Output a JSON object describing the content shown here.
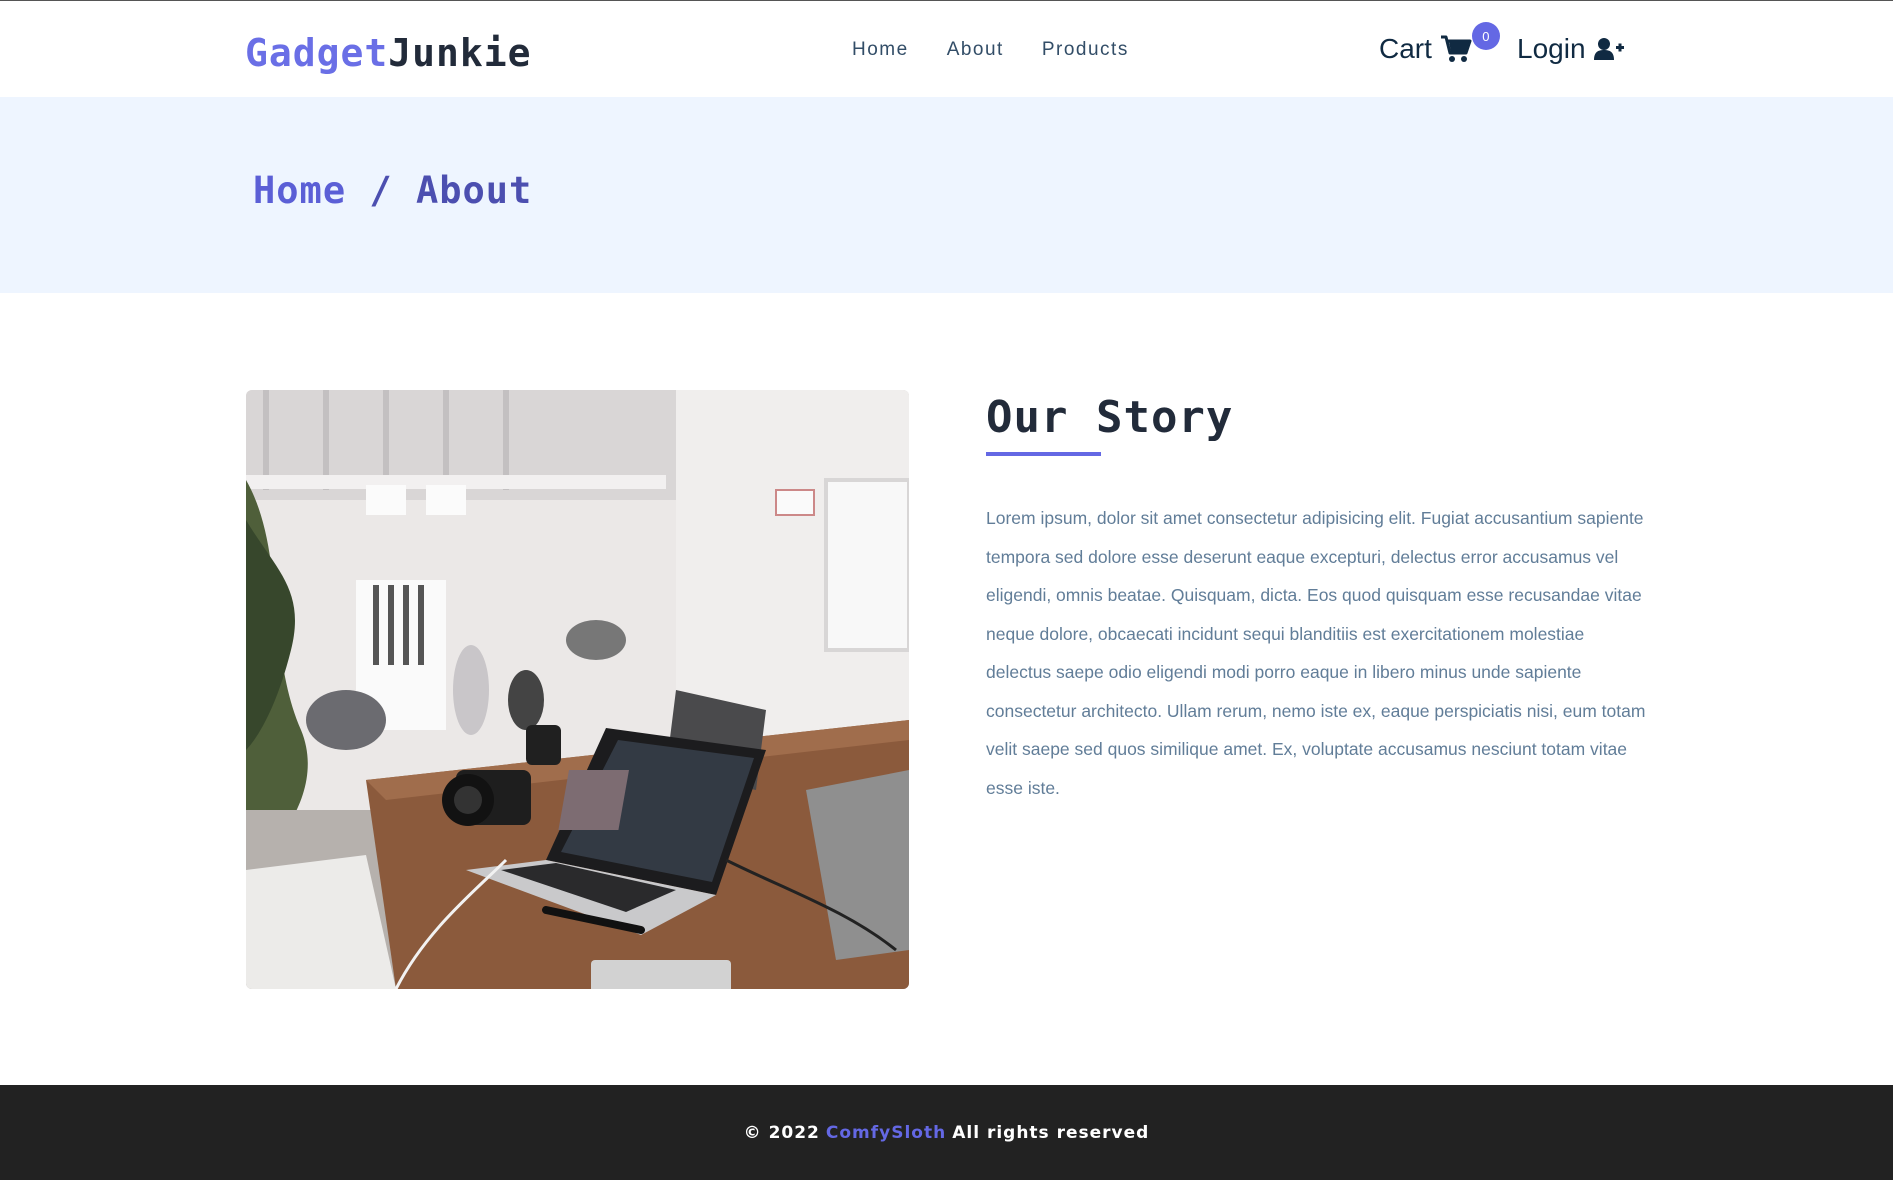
{
  "brand": {
    "part1": "Gadget",
    "part2": "Junkie"
  },
  "nav": {
    "links": [
      {
        "label": "Home"
      },
      {
        "label": "About"
      },
      {
        "label": "Products"
      }
    ],
    "cart_label": "Cart",
    "cart_count": "0",
    "login_label": "Login"
  },
  "hero": {
    "crumb_home": "Home",
    "crumb_separator": "/",
    "crumb_current": "About"
  },
  "story": {
    "title": "Our Story",
    "text": "Lorem ipsum, dolor sit amet consectetur adipisicing elit. Fugiat accusantium sapiente tempora sed dolore esse deserunt eaque excepturi, delectus error accusamus vel eligendi, omnis beatae. Quisquam, dicta. Eos quod quisquam esse recusandae vitae neque dolore, obcaecati incidunt sequi blanditiis est exercitationem molestiae delectus saepe odio eligendi modi porro eaque in libero minus unde sapiente consectetur architecto. Ullam rerum, nemo iste ex, eaque perspiciatis nisi, eum totam velit saepe sed quos similique amet. Ex, voluptate accusamus nesciunt totam vitae esse iste."
  },
  "footer": {
    "copyright": "© 2022",
    "brand": "ComfySloth",
    "rights": "All rights reserved"
  },
  "colors": {
    "accent": "#6468e4",
    "hero_bg": "#eef5ff",
    "footer_bg": "#222222",
    "text_dark": "#102a42",
    "text_muted": "#617d98"
  },
  "icons": {
    "cart": "shopping-cart-icon",
    "login": "user-plus-icon"
  }
}
